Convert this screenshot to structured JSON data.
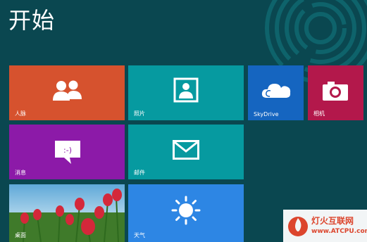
{
  "screen": {
    "title": "开始"
  },
  "tiles": {
    "people": {
      "label": "人脉"
    },
    "photos": {
      "label": "照片"
    },
    "skydrive": {
      "label": "SkyDrive"
    },
    "camera": {
      "label": "相机"
    },
    "messaging": {
      "label": "消息"
    },
    "mail": {
      "label": "邮件"
    },
    "desktop": {
      "label": "桌面"
    },
    "weather": {
      "label": "天气"
    }
  },
  "watermark": {
    "line1": "灯火互联网",
    "line2": "www.ATCPU.com"
  },
  "colors": {
    "background": "#0a4750",
    "people": "#d6522e",
    "photos": "#069aa0",
    "skydrive": "#1565c0",
    "camera": "#b3184b",
    "messaging": "#8c1aa8",
    "mail": "#069aa0",
    "weather": "#2d86e4"
  }
}
